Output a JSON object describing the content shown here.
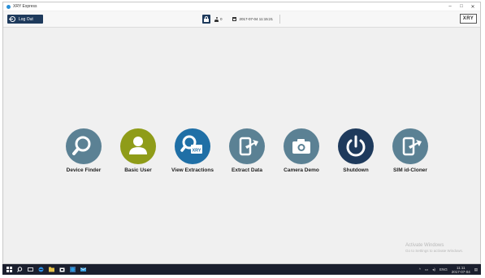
{
  "window": {
    "title": "XRY Express",
    "controls": [
      "–",
      "□",
      "✕"
    ]
  },
  "toolbar": {
    "logout_label": "Log Out",
    "user_count": "0",
    "datetime": "2017-07-04 11:15:21",
    "brand": "XRY"
  },
  "tiles": [
    {
      "label": "Device Finder",
      "color": "#5b8194",
      "icon": "search-icon"
    },
    {
      "label": "Basic User",
      "color": "#8f9c18",
      "icon": "user-icon"
    },
    {
      "label": "View Extractions",
      "color": "#1f6fa6",
      "icon": "search-xry-icon",
      "badge": "XRY"
    },
    {
      "label": "Extract Data",
      "color": "#5b8194",
      "icon": "phone-export-icon"
    },
    {
      "label": "Camera Demo",
      "color": "#5b8194",
      "icon": "camera-icon"
    },
    {
      "label": "Shutdown",
      "color": "#1e3a5c",
      "icon": "power-icon"
    },
    {
      "label": "SIM id-Cloner",
      "color": "#5b8194",
      "icon": "phone-export-icon"
    }
  ],
  "watermark": {
    "line1": "Activate Windows",
    "line2": "Go to Settings to activate Windows."
  },
  "taskbar": {
    "language": "ENG",
    "time": "11:11",
    "date": "2017-07-04"
  }
}
